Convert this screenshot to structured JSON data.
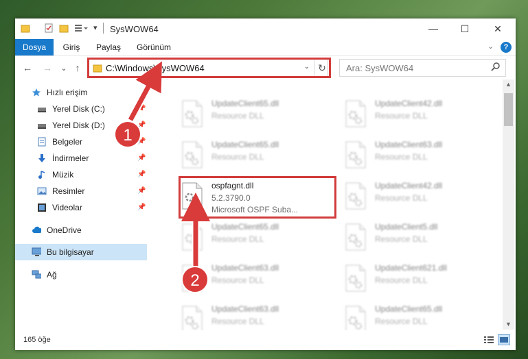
{
  "window": {
    "title": "SysWOW64",
    "controls": {
      "minimize": "—",
      "maximize": "☐",
      "close": "✕"
    }
  },
  "ribbon": {
    "tabs": [
      {
        "label": "Dosya",
        "active": true
      },
      {
        "label": "Giriş"
      },
      {
        "label": "Paylaş"
      },
      {
        "label": "Görünüm"
      }
    ],
    "help": "?"
  },
  "address": {
    "path": "C:\\Windows\\SysWOW64",
    "refresh_icon": "↻",
    "search_placeholder": "Ara: SysWOW64"
  },
  "navigation": {
    "back": "←",
    "forward": "→",
    "recent": "⌄",
    "up": "↑",
    "items": [
      {
        "label": "Hızlı erişim",
        "icon": "star-icon"
      },
      {
        "label": "Yerel Disk (C:)",
        "icon": "drive-icon",
        "pinned": true
      },
      {
        "label": "Yerel Disk (D:)",
        "icon": "drive-icon",
        "pinned": true
      },
      {
        "label": "Belgeler",
        "icon": "documents-icon",
        "pinned": true
      },
      {
        "label": "İndirmeler",
        "icon": "download-icon",
        "pinned": true
      },
      {
        "label": "Müzik",
        "icon": "music-icon",
        "pinned": true
      },
      {
        "label": "Resimler",
        "icon": "pictures-icon",
        "pinned": true
      },
      {
        "label": "Videolar",
        "icon": "videos-icon",
        "pinned": true
      },
      {
        "label": "OneDrive",
        "icon": "cloud-icon"
      },
      {
        "label": "Bu bilgisayar",
        "icon": "computer-icon",
        "selected": true
      },
      {
        "label": "Ağ",
        "icon": "network-icon"
      }
    ]
  },
  "files": [
    {
      "name": "UpdateClient65.dll",
      "type": "Resource DLL"
    },
    {
      "name": "UpdateClient42.dll",
      "type": "Resource DLL"
    },
    {
      "name": "UpdateClient65.dll",
      "type": "Resource DLL"
    },
    {
      "name": "UpdateClient63.dll",
      "type": "Resource DLL"
    },
    {
      "name": "ospfagnt.dll",
      "version": "5.2.3790.0",
      "description": "Microsoft OSPF Suba...",
      "highlighted": true
    },
    {
      "name": "UpdateClient42.dll",
      "type": "Resource DLL"
    },
    {
      "name": "UpdateClient65.dll",
      "type": "Resource DLL"
    },
    {
      "name": "UpdateClient5.dll",
      "type": "Resource DLL"
    },
    {
      "name": "UpdateClient63.dll",
      "type": "Resource DLL"
    },
    {
      "name": "UpdateClient621.dll",
      "type": "Resource DLL"
    },
    {
      "name": "UpdateClient63.dll",
      "type": "Resource DLL"
    },
    {
      "name": "UpdateClient65.dll",
      "type": "Resource DLL"
    }
  ],
  "status": {
    "count": "165 öğe"
  },
  "callouts": [
    "1",
    "2"
  ],
  "colors": {
    "accent": "#1979ca",
    "highlight": "#d23b3b",
    "selection": "#cce4f7"
  }
}
